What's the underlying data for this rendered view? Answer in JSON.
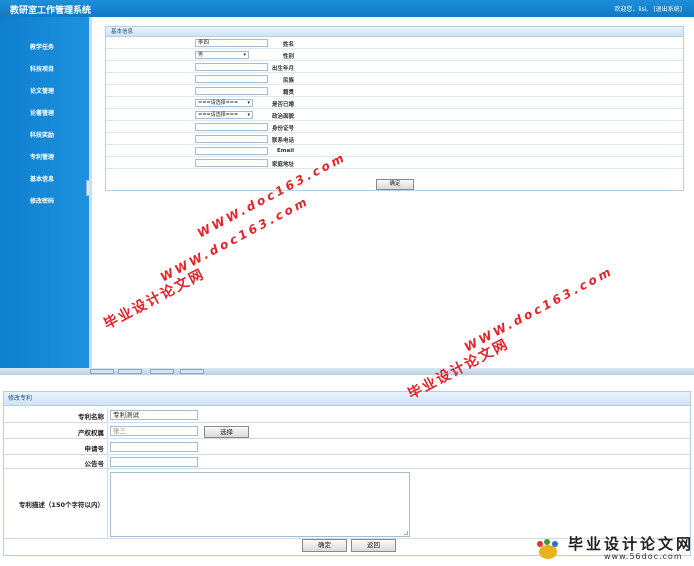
{
  "header": {
    "title": "教研室工作管理系统",
    "welcome": "欢迎您，lisi,",
    "logout": "[退出系统]"
  },
  "sidebar": {
    "items": [
      {
        "label": "教学任务"
      },
      {
        "label": "科技项目"
      },
      {
        "label": "论文管理"
      },
      {
        "label": "论著管理"
      },
      {
        "label": "科技奖励"
      },
      {
        "label": "专利管理"
      },
      {
        "label": "基本信息"
      },
      {
        "label": "修改密码"
      }
    ]
  },
  "basic_info": {
    "panel_title": "基本信息",
    "fields": [
      {
        "label": "姓名",
        "value": "李四"
      },
      {
        "label": "性别",
        "value": "男"
      },
      {
        "label": "出生年月",
        "value": ""
      },
      {
        "label": "民族",
        "value": ""
      },
      {
        "label": "籍贯",
        "value": ""
      },
      {
        "label": "是否已婚",
        "value": "===请选择==="
      },
      {
        "label": "政治面貌",
        "value": "===请选择==="
      },
      {
        "label": "身份证号",
        "value": ""
      },
      {
        "label": "联系电话",
        "value": ""
      },
      {
        "label": "Email",
        "value": ""
      },
      {
        "label": "家庭地址",
        "value": ""
      }
    ],
    "submit_label": "确定"
  },
  "patent_form": {
    "panel_title": "修改专利",
    "name_label": "专利名称",
    "name_value": "专利测试",
    "owner_label": "产权权属",
    "owner_value": "张三",
    "choose_label": "选择",
    "apply_no_label": "申请号",
    "apply_no_value": "",
    "notice_no_label": "公告号",
    "notice_no_value": "",
    "desc_label": "专利描述（150个字符以内）",
    "desc_value": "",
    "ok_label": "确定",
    "back_label": "返回"
  },
  "watermarks": {
    "cn": "毕业设计论文网",
    "url": "WWW.doc163.com",
    "corner_cn": "毕业设计论文网",
    "corner_url": "www.56doc.com"
  },
  "icons": {
    "select_arrow": "chevron-down-icon",
    "corner_logo": "paw-logo-icon"
  },
  "colors": {
    "accent": "#1179c4",
    "watermark": "#e0242a"
  }
}
